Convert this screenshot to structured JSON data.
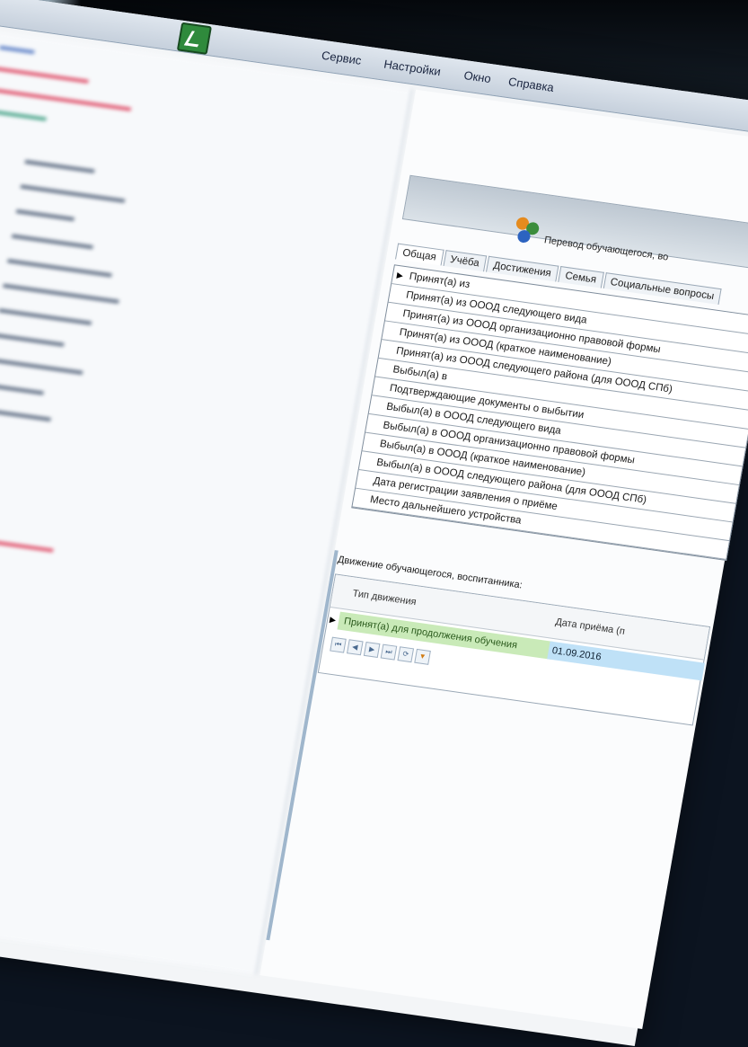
{
  "menu": {
    "items": [
      "Сервис",
      "Настройки",
      "Окно",
      "Справка"
    ]
  },
  "transfer_button": {
    "label": "Перевод обучающегося, во"
  },
  "tabs": [
    "Общая",
    "Учёба",
    "Достижения",
    "Семья",
    "Социальные вопросы"
  ],
  "fields": [
    "Принят(а) из",
    "Принят(а) из ОООД следующего вида",
    "Принят(а) из ОООД организационно правовой формы",
    "Принят(а) из ОООД (краткое наименование)",
    "Принят(а) из ОООД следующего района (для ОООД СПб)",
    "Выбыл(а) в",
    "Подтверждающие документы о выбытии",
    "Выбыл(а) в ОООД следующего вида",
    "Выбыл(а) в ОООД организационно правовой формы",
    "Выбыл(а) в ОООД (краткое наименование)",
    "Выбыл(а) в ОООД следующего района (для ОООД СПб)",
    "Дата регистрации заявления о приёме",
    "Место дальнейшего устройства"
  ],
  "movement": {
    "label": "Движение обучающегося, воспитанника:",
    "columns": [
      "Тип движения",
      "Дата приёма (п"
    ],
    "row": {
      "type": "Принят(а) для продолжения обучения",
      "date": "01.09.2016"
    }
  },
  "colors": {
    "row_green": "#c9eab8",
    "row_blue": "#bfe1f7",
    "tree_red": "#e0506a",
    "tree_green": "#4aa58a",
    "tree_blue": "#5b7fc6"
  }
}
